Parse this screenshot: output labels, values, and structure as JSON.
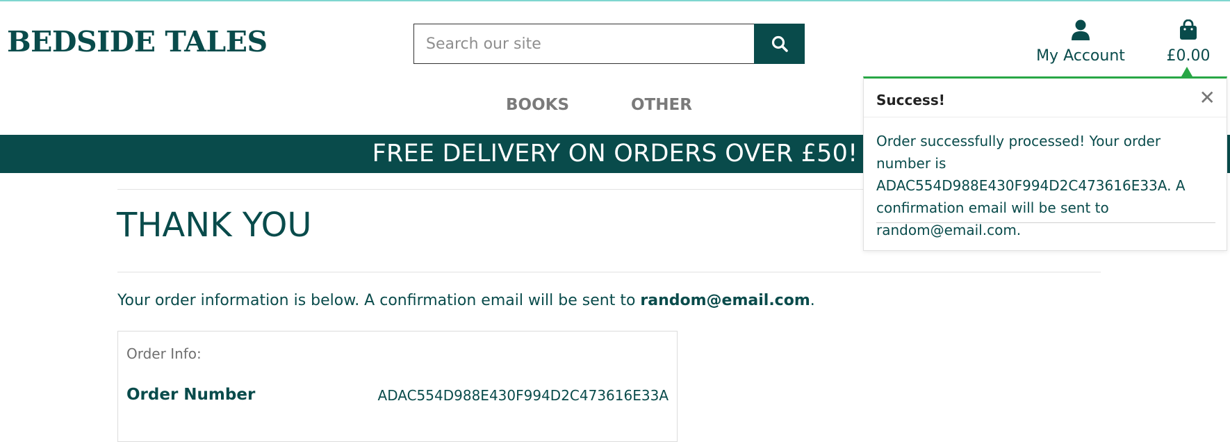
{
  "brand": {
    "logo_text": "BEDSIDE TALES",
    "accent_color": "#094b4b",
    "success_color": "#28a745"
  },
  "search": {
    "placeholder": "Search our site",
    "value": "",
    "button_icon": "search-icon"
  },
  "header": {
    "account": {
      "icon": "user-icon",
      "label": "My Account"
    },
    "bag": {
      "icon": "shopping-bag-icon",
      "total": "£0.00"
    }
  },
  "nav": {
    "items": [
      {
        "label": "BOOKS"
      },
      {
        "label": "OTHER"
      }
    ]
  },
  "banner": {
    "text": "FREE DELIVERY ON ORDERS OVER £50!"
  },
  "main": {
    "title": "THANK YOU",
    "info_prefix": "Your order information is below. A confirmation email will be sent to ",
    "email": "random@email.com",
    "info_suffix": ".",
    "order_box": {
      "caption": "Order Info:",
      "order_number_label": "Order Number",
      "order_number_value": "ADAC554D988E430F994D2C473616E33A"
    }
  },
  "toast": {
    "title": "Success!",
    "close_icon": "close-icon",
    "message": "Order successfully processed! Your order number is ADAC554D988E430F994D2C473616E33A. A confirmation email will be sent to random@email.com."
  }
}
